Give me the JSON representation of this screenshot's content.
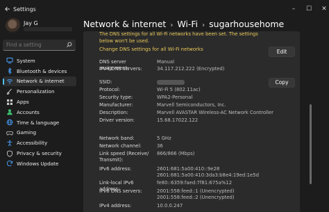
{
  "app": {
    "title": "Settings"
  },
  "window_controls": [
    "minimize",
    "maximize",
    "close"
  ],
  "profile": {
    "name": "Jay G"
  },
  "search": {
    "placeholder": "Find a setting"
  },
  "nav": [
    {
      "label": "System",
      "icon": "monitor-icon",
      "color": "#4aa3ff"
    },
    {
      "label": "Bluetooth & devices",
      "icon": "bluetooth-icon",
      "color": "#4aa3ff"
    },
    {
      "label": "Network & internet",
      "icon": "wifi-icon",
      "color": "#4aa3ff",
      "active": true
    },
    {
      "label": "Personalization",
      "icon": "brush-icon",
      "color": "#e8e8e8"
    },
    {
      "label": "Apps",
      "icon": "apps-icon",
      "color": "#c8c8c8"
    },
    {
      "label": "Accounts",
      "icon": "person-icon",
      "color": "#3fbf6f"
    },
    {
      "label": "Time & language",
      "icon": "globe-icon",
      "color": "#4aa3ff"
    },
    {
      "label": "Gaming",
      "icon": "controller-icon",
      "color": "#d0d0d0"
    },
    {
      "label": "Accessibility",
      "icon": "accessibility-icon",
      "color": "#4aa3ff"
    },
    {
      "label": "Privacy & security",
      "icon": "shield-icon",
      "color": "#c8c8c8"
    },
    {
      "label": "Windows Update",
      "icon": "update-icon",
      "color": "#4aa3ff"
    }
  ],
  "breadcrumb": {
    "part1": "Network & internet",
    "part2": "Wi-Fi",
    "part3": "sugarhousehome"
  },
  "warning": {
    "text": "The DNS settings for all Wi-Fi networks have been set. The settings below won't be used.",
    "link": "Change DNS settings for all Wi-Fi networks",
    "color": "#e9c85a"
  },
  "buttons": {
    "edit": "Edit",
    "copy": "Copy"
  },
  "properties": [
    {
      "label": "DNS server assignment:",
      "value": "Manual"
    },
    {
      "label": "IPv4 DNS servers:",
      "value": "34.117.212.222 (Encrypted)"
    },
    {
      "label": "SSID:",
      "value": "",
      "redacted": true
    },
    {
      "label": "Protocol:",
      "value": "Wi-Fi 5 (802.11ac)"
    },
    {
      "label": "Security type:",
      "value": "WPA2-Personal"
    },
    {
      "label": "Manufacturer:",
      "value": "Marvell Semiconductors, Inc."
    },
    {
      "label": "Description:",
      "value": "Marvell AVASTAR Wireless-AC Network Controller"
    },
    {
      "label": "Driver version:",
      "value": "15.68.17022.122"
    },
    {
      "label": "Network band:",
      "value": "5 GHz"
    },
    {
      "label": "Network channel:",
      "value": "36"
    },
    {
      "label": "Link speed (Receive/",
      "label2": "Transmit):",
      "value": "866/866 (Mbps)"
    },
    {
      "label": "IPv6 address:",
      "value": "2601:681:5a00:410::9e28",
      "value2": "2601:681:5a00:410:3da3:b8e4:19ed:1e5d"
    },
    {
      "label": "Link-local IPv6 address:",
      "value": "fe80::6359:faed:7f81:675a%12"
    },
    {
      "label": "IPv6 DNS servers:",
      "value": "2001:558:feed::1 (Unencrypted)",
      "value2": "2001:558:feed::2 (Unencrypted)"
    },
    {
      "label": "IPv4 address:",
      "value": "10.0.0.247"
    }
  ]
}
